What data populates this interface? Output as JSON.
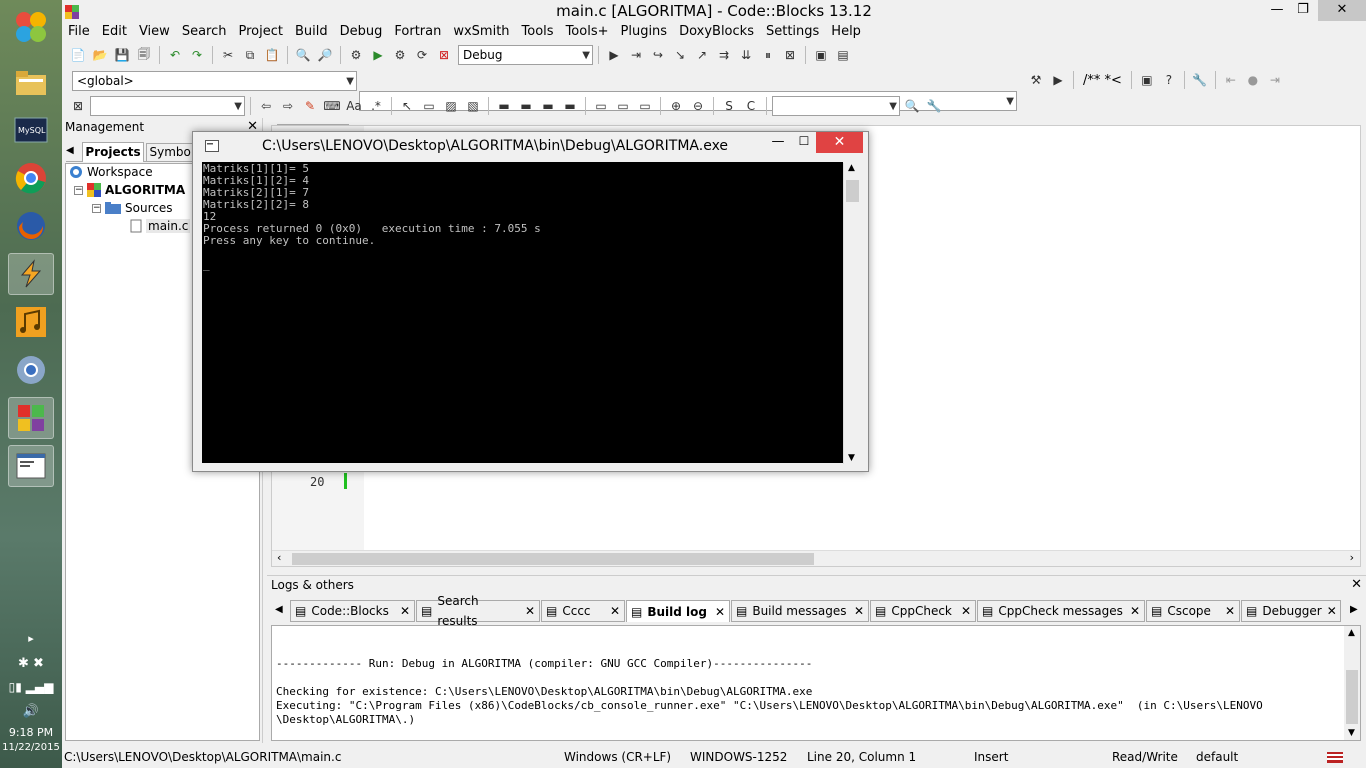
{
  "window": {
    "title": "main.c [ALGORITMA] - Code::Blocks 13.12"
  },
  "menu": [
    "File",
    "Edit",
    "View",
    "Search",
    "Project",
    "Build",
    "Debug",
    "Fortran",
    "wxSmith",
    "Tools",
    "Tools+",
    "Plugins",
    "DoxyBlocks",
    "Settings",
    "Help"
  ],
  "toolbar": {
    "build_target": "Debug",
    "scope": "<global>",
    "doxy_comment": "/** *<"
  },
  "management": {
    "title": "Management",
    "tabs": [
      "Projects",
      "Symbols"
    ],
    "tree": {
      "workspace": "Workspace",
      "project": "ALGORITMA",
      "folder": "Sources",
      "file": "main.c"
    }
  },
  "editor": {
    "line_number": "20"
  },
  "console": {
    "title": "C:\\Users\\LENOVO\\Desktop\\ALGORITMA\\bin\\Debug\\ALGORITMA.exe",
    "output": "Matriks[1][1]= 5\nMatriks[1][2]= 4\nMatriks[2][1]= 7\nMatriks[2][2]= 8\n12\nProcess returned 0 (0x0)   execution time : 7.055 s\nPress any key to continue.\n\n_"
  },
  "logs": {
    "title": "Logs & others",
    "tabs": [
      "Code::Blocks",
      "Search results",
      "Cccc",
      "Build log",
      "Build messages",
      "CppCheck",
      "CppCheck messages",
      "Cscope",
      "Debugger"
    ],
    "active_tab": "Build log",
    "content": "\n\n------------- Run: Debug in ALGORITMA (compiler: GNU GCC Compiler)---------------\n\nChecking for existence: C:\\Users\\LENOVO\\Desktop\\ALGORITMA\\bin\\Debug\\ALGORITMA.exe\nExecuting: \"C:\\Program Files (x86)\\CodeBlocks/cb_console_runner.exe\" \"C:\\Users\\LENOVO\\Desktop\\ALGORITMA\\bin\\Debug\\ALGORITMA.exe\"  (in C:\\Users\\LENOVO\n\\Desktop\\ALGORITMA\\.)"
  },
  "status": {
    "path": "C:\\Users\\LENOVO\\Desktop\\ALGORITMA\\main.c",
    "eol": "Windows (CR+LF)",
    "encoding": "WINDOWS-1252",
    "position": "Line 20, Column 1",
    "mode": "Insert",
    "access": "Read/Write",
    "profile": "default"
  },
  "tray": {
    "time": "9:18 PM",
    "date": "11/22/2015"
  }
}
